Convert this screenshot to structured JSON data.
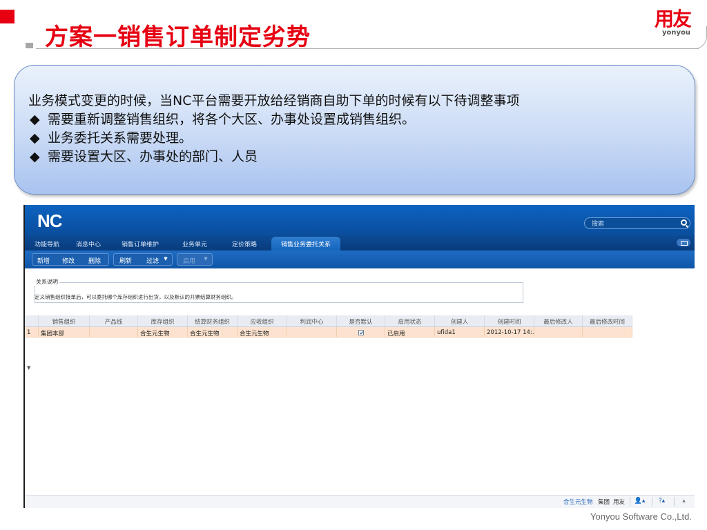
{
  "slide": {
    "title": "方案一销售订单制定劣势",
    "logo_cn": "用友",
    "logo_en": "yonyou",
    "footer": "Yonyou Software Co.,Ltd.",
    "brand_color": "#e60012"
  },
  "info": {
    "intro": "业务模式变更的时候，当NC平台需要开放给经销商自助下单的时候有以下待调整事项",
    "bullet_symbol": "◆",
    "bullets": [
      "需要重新调整销售组织，将各个大区、办事处设置成销售组织。",
      "业务委托关系需要处理。",
      "需要设置大区、办事处的部门、人员"
    ]
  },
  "nc": {
    "logo": "NC",
    "search_placeholder": "搜索",
    "nav_tabs": [
      "功能导航",
      "消息中心",
      "销售订单维护",
      "业务单元",
      "定价策略",
      "销售业务委托关系"
    ],
    "toolbar": {
      "add": "新增",
      "edit": "修改",
      "delete": "删除",
      "refresh": "刷新",
      "filter": "过滤",
      "enable": "启用"
    },
    "relation": {
      "label": "关系说明",
      "desc": "定义销售组织接单后，可以委托哪个库存组织进行出货，以及默认的开票结算财务组织。"
    },
    "columns": [
      "销售组织",
      "产品线",
      "库存组织",
      "结算财务组织",
      "应收组织",
      "利润中心",
      "是否默认",
      "启用状态",
      "创建人",
      "创建时间",
      "最后修改人",
      "最后修改时间"
    ],
    "rows": [
      {
        "index": "1",
        "sales_org": "集团本部",
        "product_line": "",
        "stock_org": "合生元生物",
        "finance_org": "合生元生物",
        "receivable_org": "合生元生物",
        "profit_center": "",
        "status": "已启用",
        "creator": "ufida1",
        "created": "2012-10-17 14:...",
        "modifier": "",
        "modified": ""
      }
    ],
    "status_bar": {
      "org": "合生元生物",
      "group": "集团",
      "user": "用友"
    }
  }
}
